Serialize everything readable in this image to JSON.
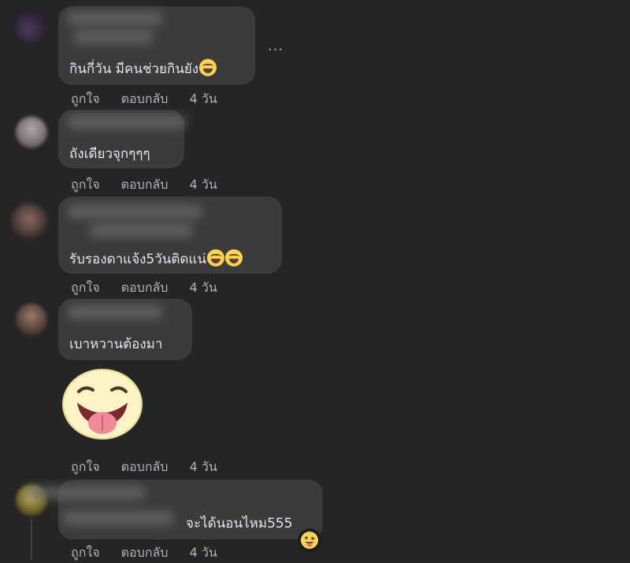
{
  "comments": [
    {
      "text": "กินกี่วัน มีคนช่วยกินยัง",
      "like": "ถูกใจ",
      "reply": "ตอบกลับ",
      "time": "4 วัน"
    },
    {
      "text": "ถังเดียวจุกๆๆๆ",
      "like": "ถูกใจ",
      "reply": "ตอบกลับ",
      "time": "4 วัน"
    },
    {
      "text": "รับรองดาแจ้ง5วันติดแน่",
      "like": "ถูกใจ",
      "reply": "ตอบกลับ",
      "time": "4 วัน"
    },
    {
      "text": "เบาหวานต้องมา",
      "like": "ถูกใจ",
      "reply": "ตอบกลับ",
      "time": "4 วัน"
    },
    {
      "text": "จะได้นอนไหม555",
      "like": "ถูกใจ",
      "reply": "ตอบกลับ",
      "time": "4 วัน"
    }
  ],
  "more_label": "...",
  "colors": {
    "background": "#242526",
    "bubble": "#3a3b3c",
    "text": "#e4e6eb",
    "secondary_text": "#b0b3b8"
  },
  "icons": [
    "laugh-cry-emoji-icon",
    "tongue-out-sticker-icon",
    "more-options-icon",
    "tongue-emoji-icon"
  ]
}
